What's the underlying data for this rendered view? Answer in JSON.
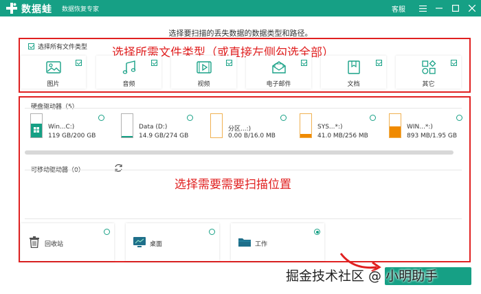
{
  "titlebar": {
    "brand": "数据蛙",
    "subtitle": "数据恢复专家",
    "service": "客服"
  },
  "instruction": "选择要扫描的丢失数据的数据类型和路径。",
  "file_types": {
    "select_all": "选择所有文件类型",
    "items": [
      {
        "label": "图片",
        "icon": "image-icon",
        "checked": true
      },
      {
        "label": "音频",
        "icon": "music-icon",
        "checked": true
      },
      {
        "label": "视频",
        "icon": "video-icon",
        "checked": true
      },
      {
        "label": "电子邮件",
        "icon": "mail-icon",
        "checked": true
      },
      {
        "label": "文档",
        "icon": "document-icon",
        "checked": true
      },
      {
        "label": "其它",
        "icon": "shapes-icon",
        "checked": true
      }
    ]
  },
  "annotations": {
    "types": "选择所需文件类型（或直接左侧勾选全部）",
    "location": "选择需要需要扫描位置"
  },
  "drives": {
    "title": "硬盘驱动器（5）",
    "items": [
      {
        "name": "Win...C:)",
        "size": "119 GB/200 GB",
        "icon": "windows-drive-icon",
        "fill": 0.595,
        "color": "#16a085"
      },
      {
        "name": "Data (D:)",
        "size": "14.9 GB/274 GB",
        "icon": "drive-icon",
        "fill": 0.054,
        "color": "#16a085"
      },
      {
        "name": "分区...:)",
        "size": "0.00  B/16.0 MB",
        "icon": "drive-icon",
        "fill": 0.0,
        "color": "#f0a030"
      },
      {
        "name": "SYS...*:)",
        "size": "41.0 MB/256 MB",
        "icon": "drive-icon",
        "fill": 0.16,
        "color": "#f08a00"
      },
      {
        "name": "WIN...*:)",
        "size": "893 MB/1.95 GB",
        "icon": "drive-icon",
        "fill": 0.457,
        "color": "#f08a00"
      }
    ]
  },
  "removable": {
    "title": "可移动驱动器（0）",
    "refresh_icon": "refresh-icon"
  },
  "locations": {
    "items": [
      {
        "label": "回收站",
        "icon": "recycle-bin-icon",
        "selected": false
      },
      {
        "label": "桌面",
        "icon": "desktop-icon",
        "selected": false
      },
      {
        "label": "工作",
        "icon": "folder-icon",
        "selected": true
      }
    ]
  },
  "watermark": "掘金技术社区 @ 小明助手",
  "colors": {
    "accent": "#16a085",
    "annotation": "#e02020"
  }
}
